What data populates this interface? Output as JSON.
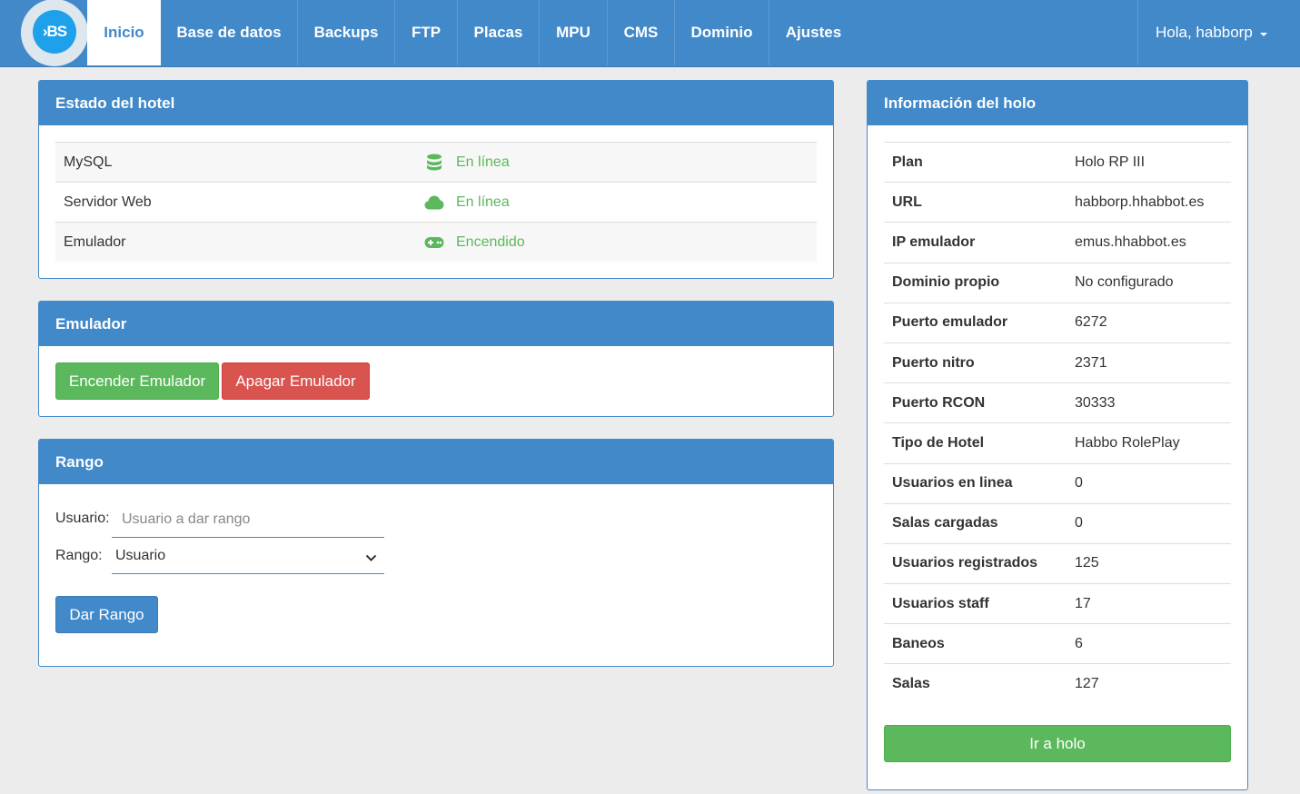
{
  "logo": {
    "text": "›BS"
  },
  "nav": {
    "items": [
      {
        "label": "Inicio",
        "active": true
      },
      {
        "label": "Base de datos"
      },
      {
        "label": "Backups"
      },
      {
        "label": "FTP"
      },
      {
        "label": "Placas"
      },
      {
        "label": "MPU"
      },
      {
        "label": "CMS"
      },
      {
        "label": "Dominio"
      },
      {
        "label": "Ajustes"
      }
    ],
    "user": "Hola, habborp"
  },
  "hotel_status": {
    "title": "Estado del hotel",
    "rows": [
      {
        "label": "MySQL",
        "icon": "database-icon",
        "value": "En línea"
      },
      {
        "label": "Servidor Web",
        "icon": "cloud-icon",
        "value": "En línea"
      },
      {
        "label": "Emulador",
        "icon": "gamepad-icon",
        "value": "Encendido"
      }
    ]
  },
  "emulator": {
    "title": "Emulador",
    "start_label": "Encender Emulador",
    "stop_label": "Apagar Emulador"
  },
  "rank": {
    "title": "Rango",
    "user_label": "Usuario:",
    "user_placeholder": "Usuario a dar rango",
    "rank_label": "Rango:",
    "rank_selected": "Usuario",
    "submit_label": "Dar Rango"
  },
  "holo_info": {
    "title": "Información del holo",
    "rows": [
      {
        "label": "Plan",
        "value": "Holo RP III"
      },
      {
        "label": "URL",
        "value": "habborp.hhabbot.es"
      },
      {
        "label": "IP emulador",
        "value": "emus.hhabbot.es"
      },
      {
        "label": "Dominio propio",
        "value": "No configurado"
      },
      {
        "label": "Puerto emulador",
        "value": "6272"
      },
      {
        "label": "Puerto nitro",
        "value": "2371"
      },
      {
        "label": "Puerto RCON",
        "value": "30333"
      },
      {
        "label": "Tipo de Hotel",
        "value": "Habbo RolePlay"
      },
      {
        "label": "Usuarios en linea",
        "value": "0"
      },
      {
        "label": "Salas cargadas",
        "value": "0"
      },
      {
        "label": "Usuarios registrados",
        "value": "125"
      },
      {
        "label": "Usuarios staff",
        "value": "17"
      },
      {
        "label": "Baneos",
        "value": "6"
      },
      {
        "label": "Salas",
        "value": "127"
      }
    ],
    "go_label": "Ir a holo"
  },
  "colors": {
    "primary": "#4289c9",
    "success": "#5cb85c",
    "danger": "#d9534f",
    "background": "#ececec"
  }
}
